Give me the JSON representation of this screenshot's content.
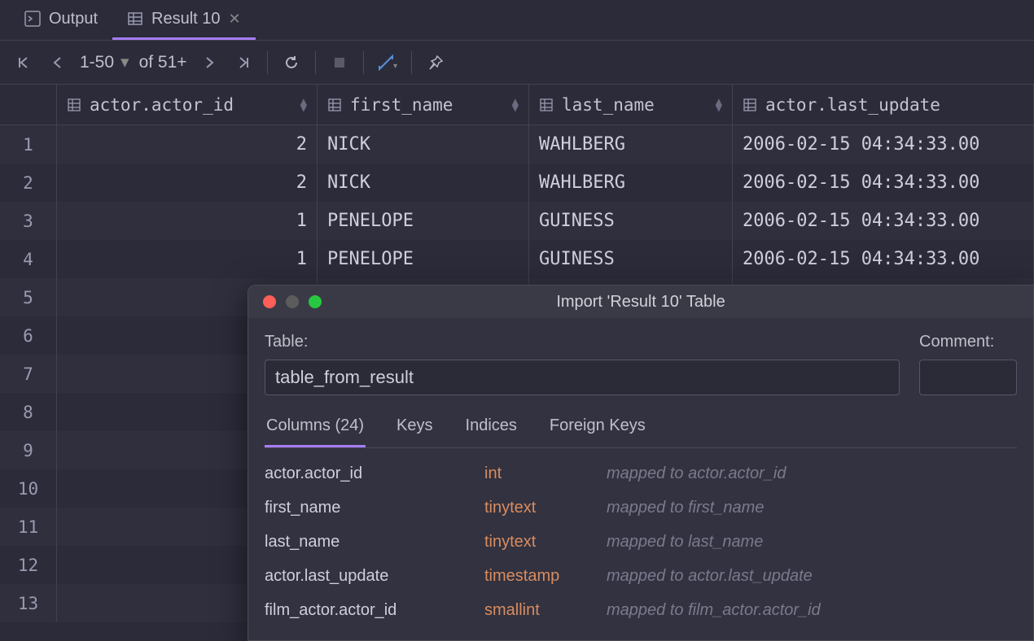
{
  "tabs": [
    {
      "label": "Output",
      "active": false,
      "closable": false
    },
    {
      "label": "Result 10",
      "active": true,
      "closable": true
    }
  ],
  "toolbar": {
    "range": "1-50",
    "of": "of 51+"
  },
  "columns": [
    {
      "label": "actor.actor_id",
      "sortable": true
    },
    {
      "label": "first_name",
      "sortable": true
    },
    {
      "label": "last_name",
      "sortable": true
    },
    {
      "label": "actor.last_update",
      "sortable": false
    }
  ],
  "rows": [
    {
      "n": "1",
      "id": "2",
      "fn": "NICK",
      "ln": "WAHLBERG",
      "lu": "2006-02-15 04:34:33.00"
    },
    {
      "n": "2",
      "id": "2",
      "fn": "NICK",
      "ln": "WAHLBERG",
      "lu": "2006-02-15 04:34:33.00"
    },
    {
      "n": "3",
      "id": "1",
      "fn": "PENELOPE",
      "ln": "GUINESS",
      "lu": "2006-02-15 04:34:33.00"
    },
    {
      "n": "4",
      "id": "1",
      "fn": "PENELOPE",
      "ln": "GUINESS",
      "lu": "2006-02-15 04:34:33.00"
    },
    {
      "n": "5",
      "id": "",
      "fn": "",
      "ln": "",
      "lu": ""
    },
    {
      "n": "6",
      "id": "",
      "fn": "",
      "ln": "",
      "lu": ""
    },
    {
      "n": "7",
      "id": "",
      "fn": "",
      "ln": "",
      "lu": ""
    },
    {
      "n": "8",
      "id": "",
      "fn": "",
      "ln": "",
      "lu": ""
    },
    {
      "n": "9",
      "id": "",
      "fn": "",
      "ln": "",
      "lu": ""
    },
    {
      "n": "10",
      "id": "",
      "fn": "",
      "ln": "",
      "lu": ""
    },
    {
      "n": "11",
      "id": "",
      "fn": "",
      "ln": "",
      "lu": ""
    },
    {
      "n": "12",
      "id": "",
      "fn": "",
      "ln": "",
      "lu": ""
    },
    {
      "n": "13",
      "id": "",
      "fn": "",
      "ln": "",
      "lu": ""
    }
  ],
  "dialog": {
    "title": "Import 'Result 10' Table",
    "table_label": "Table:",
    "table_value": "table_from_result",
    "comment_label": "Comment:",
    "tabs": [
      "Columns (24)",
      "Keys",
      "Indices",
      "Foreign Keys"
    ],
    "active_tab": 0,
    "columns": [
      {
        "name": "actor.actor_id",
        "type": "int",
        "map": "mapped to actor.actor_id"
      },
      {
        "name": "first_name",
        "type": "tinytext",
        "map": "mapped to first_name"
      },
      {
        "name": "last_name",
        "type": "tinytext",
        "map": "mapped to last_name"
      },
      {
        "name": "actor.last_update",
        "type": "timestamp",
        "map": "mapped to actor.last_update"
      },
      {
        "name": "film_actor.actor_id",
        "type": "smallint",
        "map": "mapped to film_actor.actor_id"
      }
    ]
  }
}
